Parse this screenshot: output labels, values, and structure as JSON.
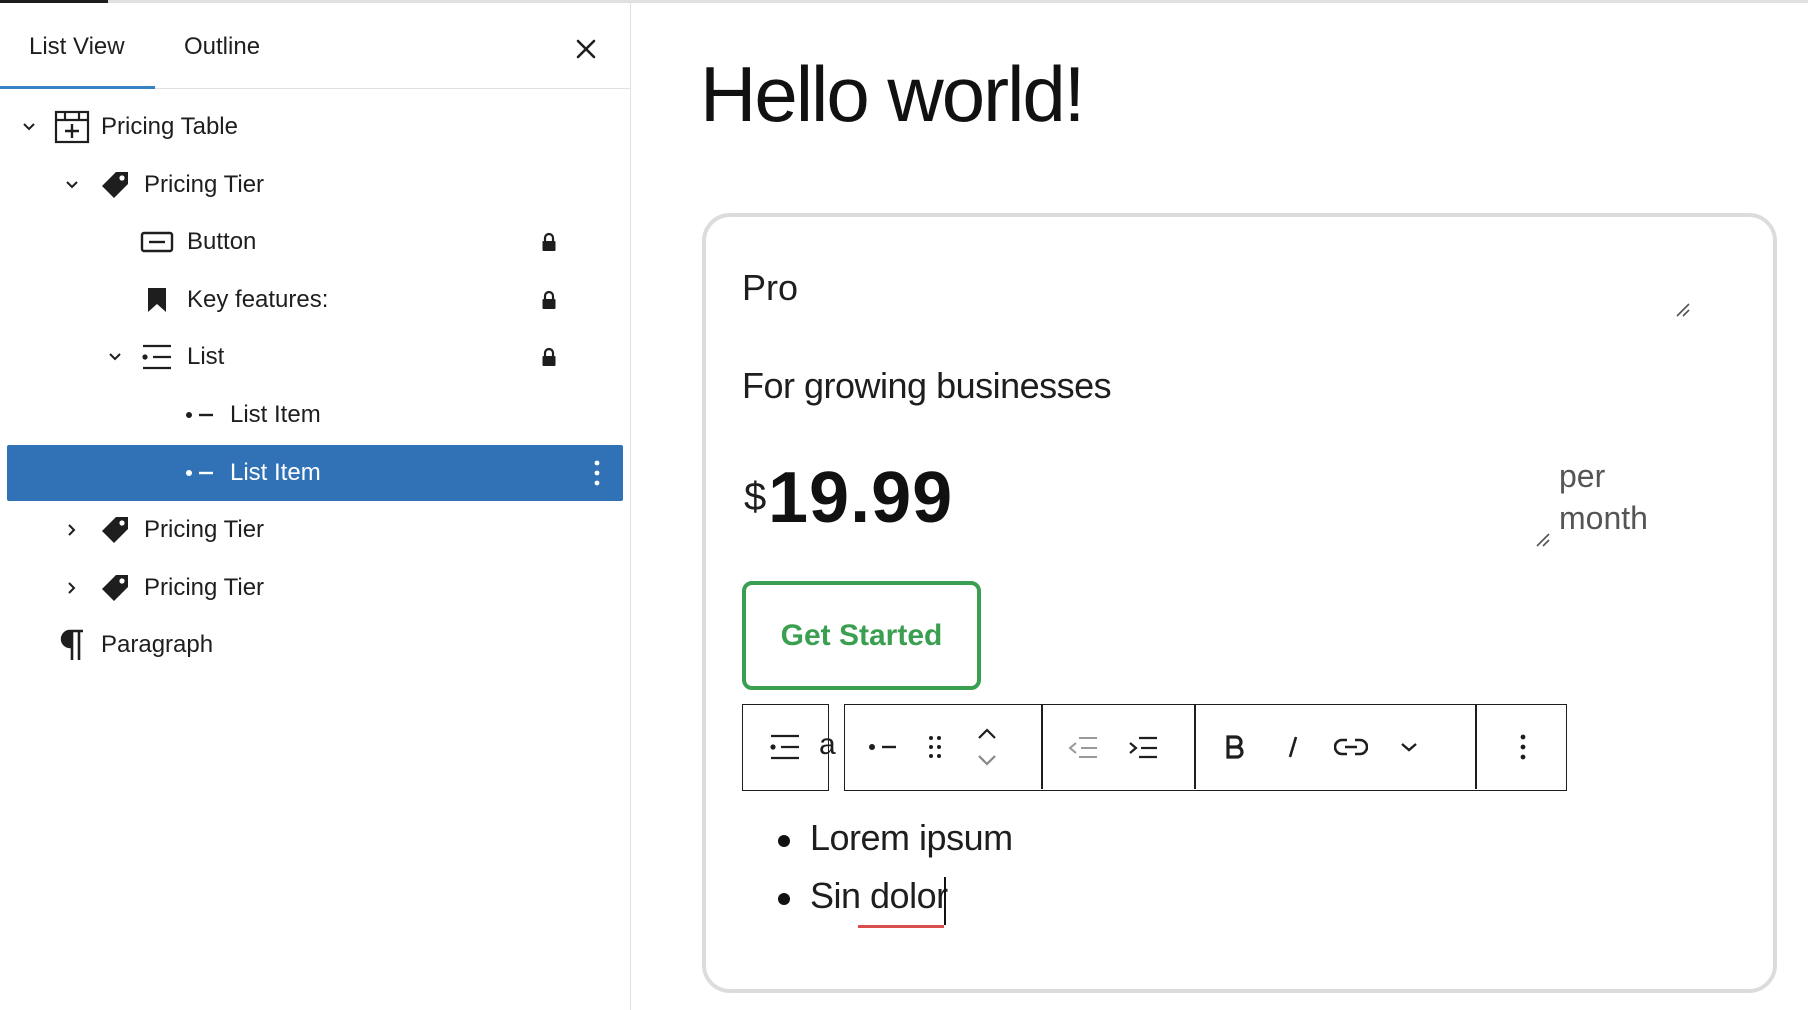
{
  "sidebar": {
    "tabs": [
      {
        "label": "List View",
        "active": true
      },
      {
        "label": "Outline",
        "active": false
      }
    ],
    "close_icon": "close-icon",
    "tree": [
      {
        "label": "Pricing Table",
        "icon": "table-icon",
        "expanded": true,
        "locked": false,
        "selected": false
      },
      {
        "label": "Pricing Tier",
        "icon": "tag-icon",
        "expanded": true,
        "locked": false,
        "selected": false
      },
      {
        "label": "Button",
        "icon": "button-icon",
        "locked": true,
        "selected": false
      },
      {
        "label": "Key features:",
        "icon": "bookmark-icon",
        "locked": true,
        "selected": false
      },
      {
        "label": "List",
        "icon": "list-icon",
        "expanded": true,
        "locked": true,
        "selected": false
      },
      {
        "label": "List Item",
        "icon": "list-item-icon",
        "locked": false,
        "selected": false
      },
      {
        "label": "List Item",
        "icon": "list-item-icon",
        "locked": false,
        "selected": true
      },
      {
        "label": "Pricing Tier",
        "icon": "tag-icon",
        "expanded": false,
        "locked": false,
        "selected": false
      },
      {
        "label": "Pricing Tier",
        "icon": "tag-icon",
        "expanded": false,
        "locked": false,
        "selected": false
      },
      {
        "label": "Paragraph",
        "icon": "paragraph-icon",
        "locked": false,
        "selected": false
      }
    ]
  },
  "editor": {
    "post_title": "Hello world!",
    "card": {
      "tier_name": "Pro",
      "description": "For growing businesses",
      "currency": "$",
      "price": "19.99",
      "period_line1": "per",
      "period_line2": "month",
      "cta_label": "Get Started",
      "peek_text": "a",
      "list_items": [
        "Lorem ipsum",
        "Sin dolor"
      ]
    },
    "toolbar": {
      "icons": [
        "list-parent-icon",
        "list-item-icon",
        "drag-handle-icon",
        "move-up-icon",
        "move-down-icon",
        "outdent-icon",
        "indent-icon",
        "bold-icon",
        "italic-icon",
        "link-icon",
        "more-formatting-chevron-icon",
        "more-options-icon"
      ]
    }
  },
  "colors": {
    "accent": "#3582c4",
    "selected_row": "#3172b6",
    "cta_green": "#3a9f50",
    "spellcheck": "#d94f4f"
  }
}
